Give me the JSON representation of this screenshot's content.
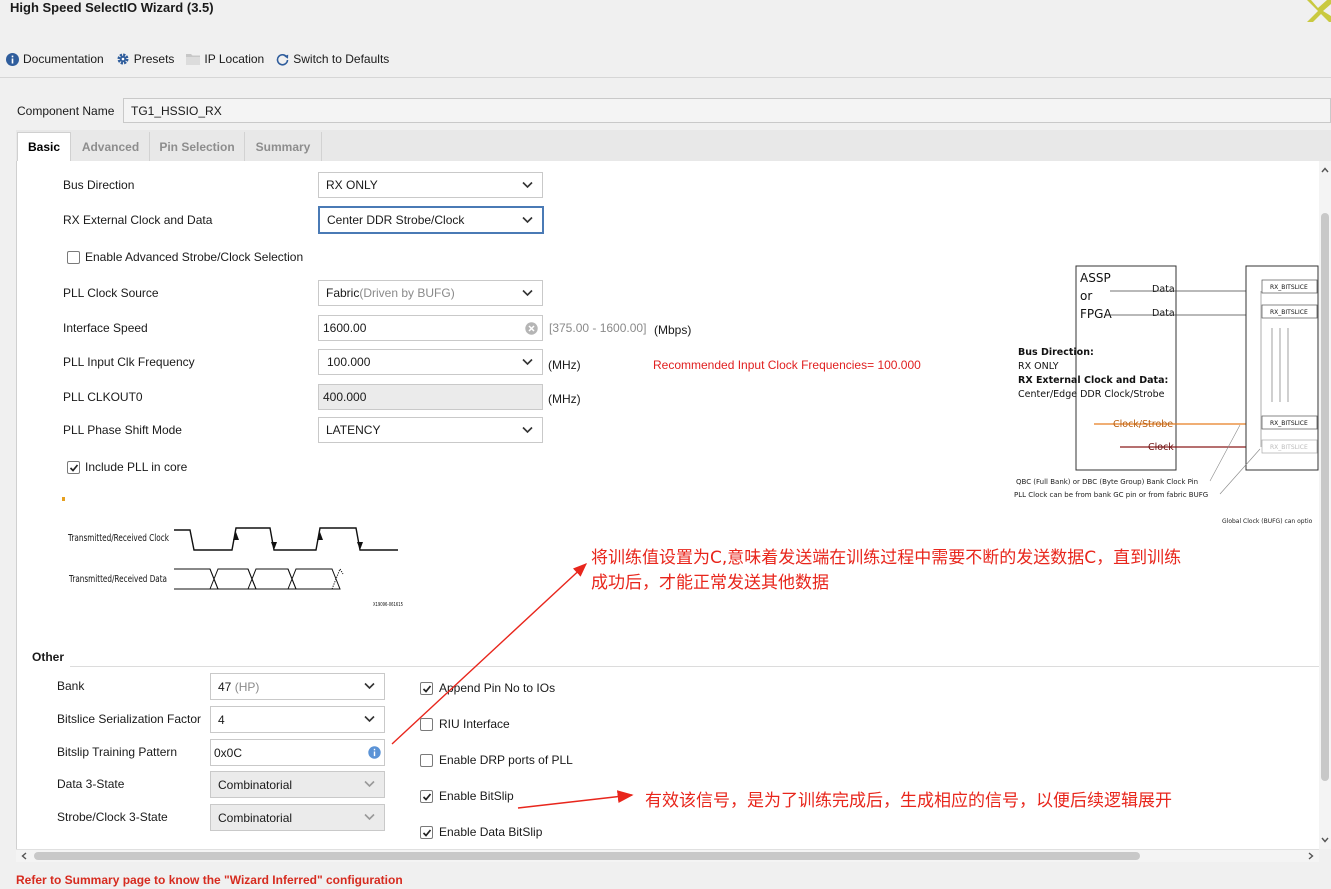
{
  "window": {
    "title": "High Speed SelectIO Wizard (3.5)"
  },
  "toolbar": {
    "documentation": "Documentation",
    "presets": "Presets",
    "ip_location": "IP Location",
    "switch_defaults": "Switch to Defaults"
  },
  "component": {
    "label": "Component Name",
    "value": "TG1_HSSIO_RX"
  },
  "tabs": [
    "Basic",
    "Advanced",
    "Pin Selection",
    "Summary"
  ],
  "basic": {
    "bus_direction": {
      "label": "Bus Direction",
      "value": "RX ONLY"
    },
    "rx_ext_clock": {
      "label": "RX External Clock and Data",
      "value": "Center DDR Strobe/Clock"
    },
    "enable_adv_strobe": {
      "label": "Enable Advanced Strobe/Clock Selection",
      "checked": false
    },
    "pll_clock_source": {
      "label": "PLL Clock Source",
      "value": "Fabric",
      "hint": "(Driven by BUFG)"
    },
    "interface_speed": {
      "label": "Interface Speed",
      "value": "1600.00",
      "range": "[375.00 - 1600.00]",
      "unit": "(Mbps)"
    },
    "pll_input_clk": {
      "label": "PLL Input Clk Frequency",
      "value": "100.000",
      "unit": "(MHz)"
    },
    "recommended": "Recommended Input Clock Frequencies= 100.000",
    "pll_clkout0": {
      "label": "PLL CLKOUT0",
      "value": "400.000",
      "unit": "(MHz)"
    },
    "pll_phase_shift": {
      "label": "PLL Phase Shift Mode",
      "value": "LATENCY"
    },
    "include_pll": {
      "label": "Include PLL in core",
      "checked": true
    }
  },
  "timing_diagram": {
    "clock_label": "Transmitted/Received Clock",
    "data_label": "Transmitted/Received Data",
    "figure_id": "X19096-061615"
  },
  "block_diagram": {
    "source": [
      "ASSP",
      "or",
      "FPGA"
    ],
    "data_label": "Data",
    "bus_dir_title": "Bus Direction:",
    "bus_dir_value": "RX ONLY",
    "ext_clock_title": "RX External Clock and Data:",
    "ext_clock_value": "Center/Edge DDR Clock/Strobe",
    "clock_strobe": "Clock/Strobe",
    "clock": "Clock",
    "bitslice": "RX_BITSLICE",
    "note1": "QBC (Full Bank) or DBC (Byte Group) Bank Clock Pin",
    "note2": "PLL Clock can be from bank GC pin or from fabric BUFG",
    "note3": "Global Clock (BUFG) can optio"
  },
  "other": {
    "heading": "Other",
    "bank": {
      "label": "Bank",
      "value": "47",
      "hint": "(HP)"
    },
    "serialization": {
      "label": "Bitslice Serialization Factor",
      "value": "4"
    },
    "bitslip_pattern": {
      "label": "Bitslip Training Pattern",
      "value": "0x0C"
    },
    "data_3state": {
      "label": "Data 3-State",
      "value": "Combinatorial"
    },
    "strobe_3state": {
      "label": "Strobe/Clock 3-State",
      "value": "Combinatorial"
    },
    "append_pin": {
      "label": "Append Pin No to IOs",
      "checked": true
    },
    "riu": {
      "label": "RIU Interface",
      "checked": false
    },
    "drp": {
      "label": "Enable DRP ports of PLL",
      "checked": false
    },
    "bitslip": {
      "label": "Enable BitSlip",
      "checked": true
    },
    "data_bitslip": {
      "label": "Enable Data BitSlip",
      "checked": true
    }
  },
  "annotations": {
    "note1_line1": "将训练值设置为C,意味着发送端在训练过程中需要不断的发送数据C，直到训练",
    "note1_line2": "成功后，才能正常发送其他数据",
    "note2": "有效该信号，是为了训练完成后，生成相应的信号，以便后续逻辑展开"
  },
  "footer": {
    "message": "Refer to Summary page to know the \"Wizard Inferred\" configuration"
  },
  "colors": {
    "accent": "#4a7ab5",
    "annotation": "#e8261c",
    "footer_warning": "#d62b1f",
    "orange_trace": "#e67e22",
    "dark_red_trace": "#8b1a1a"
  }
}
